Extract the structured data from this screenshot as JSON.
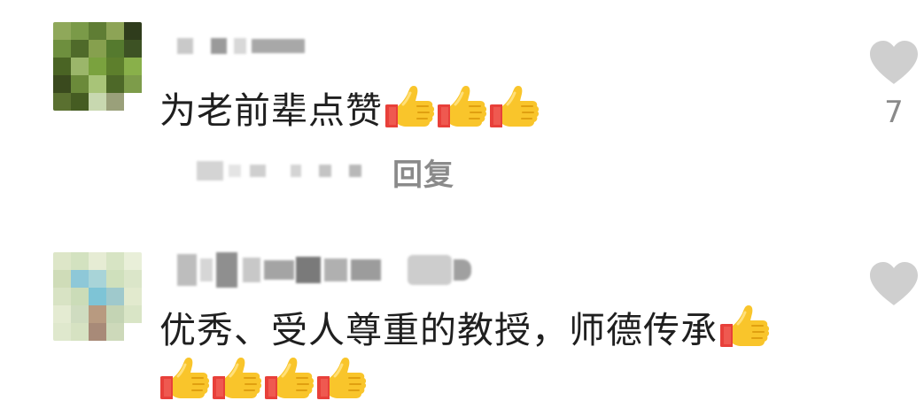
{
  "comments": [
    {
      "text": "为老前辈点赞",
      "emoji": "thumbs-up",
      "like_count": "7",
      "reply_label": "回复"
    },
    {
      "text": "优秀、受人尊重的教授，师德传承",
      "emoji": "thumbs-up"
    }
  ],
  "icons": {
    "like": "heart-icon",
    "emoji": "thumbs-up-icon"
  },
  "colors": {
    "text": "#1f1f1f",
    "muted": "#8a8a8a",
    "heart": "#cfcfcf"
  }
}
